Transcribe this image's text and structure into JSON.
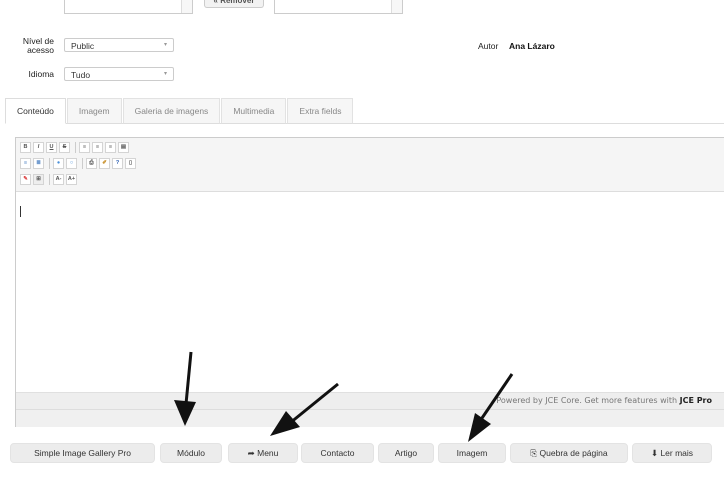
{
  "top": {
    "remove_button": "« Remover"
  },
  "access": {
    "label_line1": "Nível de",
    "label_line2": "acesso",
    "value": "Public"
  },
  "language": {
    "label": "Idioma",
    "value": "Tudo"
  },
  "author": {
    "label": "Autor",
    "value": "Ana Lázaro"
  },
  "tabs": [
    {
      "label": "Conteúdo",
      "active": true
    },
    {
      "label": "Imagem",
      "active": false
    },
    {
      "label": "Galeria de imagens",
      "active": false
    },
    {
      "label": "Multimedia",
      "active": false
    },
    {
      "label": "Extra fields",
      "active": false
    }
  ],
  "toolbar": {
    "row1": [
      "B",
      "I",
      "U",
      "S",
      "align-left",
      "align-center",
      "align-right",
      "align-justify"
    ],
    "row2": [
      "indent",
      "outdent",
      "link",
      "unlink",
      "print",
      "cleanup",
      "help",
      "preview"
    ],
    "row3": [
      "eraser",
      "table",
      "A-",
      "A+"
    ]
  },
  "statusbar": {
    "text": "Powered by JCE Core. Get more features with ",
    "bold": "JCE Pro"
  },
  "editor_buttons": [
    {
      "label": "Simple Image Gallery Pro",
      "icon": ""
    },
    {
      "label": "Módulo",
      "icon": ""
    },
    {
      "label": "Menu",
      "icon": "share-arrow-icon"
    },
    {
      "label": "Contacto",
      "icon": ""
    },
    {
      "label": "Artigo",
      "icon": ""
    },
    {
      "label": "Imagem",
      "icon": ""
    },
    {
      "label": "Quebra de página",
      "icon": "copy-icon"
    },
    {
      "label": "Ler mais",
      "icon": "arrow-down-icon"
    }
  ]
}
